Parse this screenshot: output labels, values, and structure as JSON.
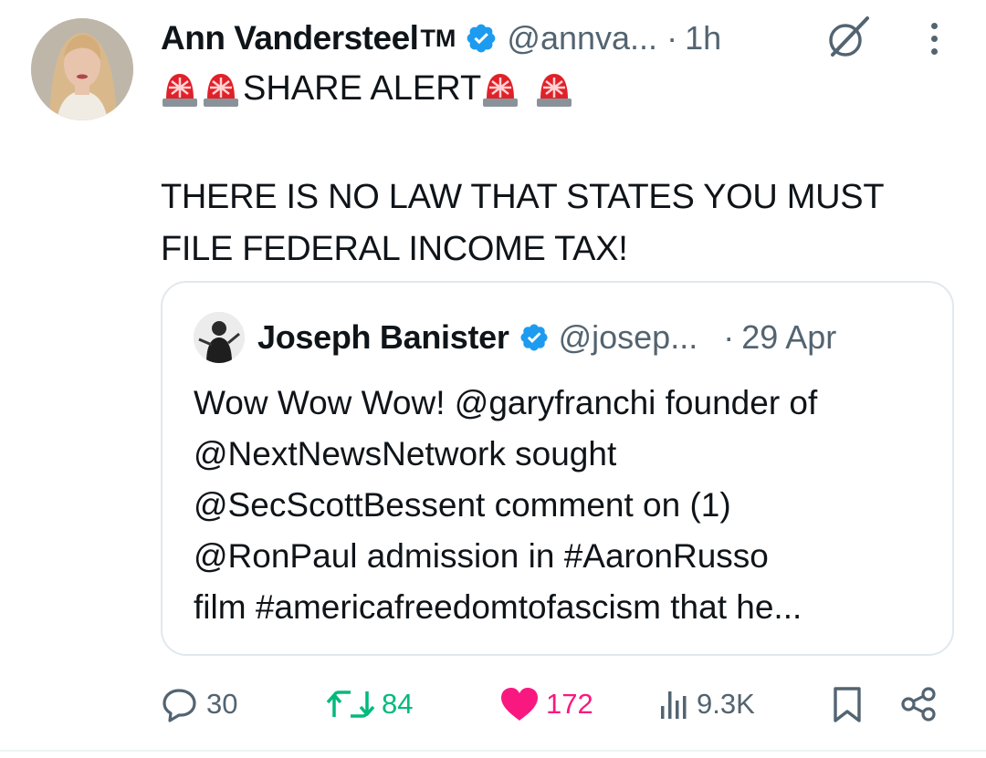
{
  "tweet": {
    "author_name": "Ann Vandersteel",
    "author_suffix": "TM",
    "handle": "@annva...",
    "separator": "·",
    "time": "1h",
    "alert_text": "SHARE ALERT",
    "body_line1": "THERE IS NO LAW THAT STATES YOU MUST",
    "body_line2": "FILE FEDERAL INCOME TAX!"
  },
  "quote": {
    "author_name": "Joseph Banister",
    "handle": "@josep...",
    "separator": "·",
    "date": "29 Apr",
    "lines": [
      "Wow Wow Wow! @garyfranchi founder of",
      "@NextNewsNetwork sought",
      "@SecScottBessent comment on (1)",
      "@RonPaul admission in #AaronRusso",
      "film #americafreedomtofascism that he..."
    ]
  },
  "actions": {
    "replies": "30",
    "reposts": "84",
    "likes": "172",
    "views": "9.3K"
  },
  "icons": [
    "verified-badge-icon",
    "grok-icon",
    "more-icon",
    "siren-icon",
    "reply-icon",
    "retweet-icon",
    "heart-icon",
    "views-icon",
    "bookmark-icon",
    "share-icon"
  ],
  "colors": {
    "verified": "#1d9bf0",
    "repost": "#00ba7c",
    "like": "#f91880",
    "muted": "#536471",
    "text": "#0f1419"
  }
}
